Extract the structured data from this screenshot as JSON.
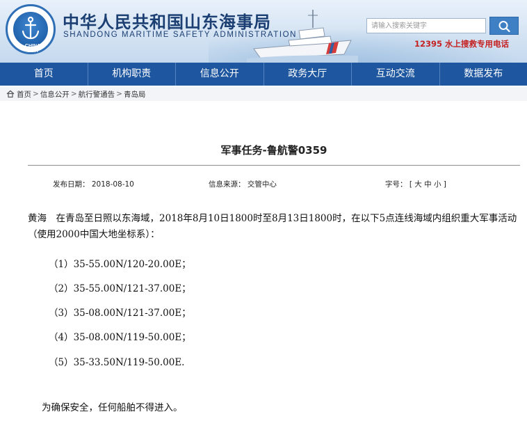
{
  "header": {
    "logo_text": "CHINA MSA",
    "title": "中华人民共和国山东海事局",
    "subtitle": "SHANDONG MARITIME SAFETY ADMINISTRATION",
    "search_placeholder": "请输入搜索关键字",
    "hotline": "12395 水上搜救专用电话"
  },
  "nav": {
    "items": [
      "首页",
      "机构职责",
      "信息公开",
      "政务大厅",
      "互动交流",
      "数据发布"
    ]
  },
  "breadcrumb": {
    "items": [
      "首页",
      "信息公开",
      "航行警通告",
      "青岛局"
    ]
  },
  "article": {
    "title": "军事任务-鲁航警0359",
    "publish_date_label": "发布日期：",
    "publish_date": "2018-08-10",
    "source_label": "信息来源：",
    "source": "交管中心",
    "font_size_label": "字号：",
    "font_size_controls": "[ 大 中 小 ]",
    "paragraph": "黄海　在青岛至日照以东海域，2018年8月10日1800时至8月13日1800时，在以下5点连线海域内组织重大军事活动（使用2000中国大地坐标系）：",
    "coordinates": [
      "（1）35-55.00N/120-20.00E；",
      "（2）35-55.00N/121-37.00E；",
      "（3）35-08.00N/121-37.00E；",
      "（4）35-08.00N/119-50.00E；",
      "（5）35-33.50N/119-50.00E."
    ],
    "closing": "为确保安全，任何船舶不得进入。"
  },
  "colors": {
    "nav_bg": "#1e56a0",
    "title_text": "#1b3f73",
    "hotline": "#c52121"
  }
}
